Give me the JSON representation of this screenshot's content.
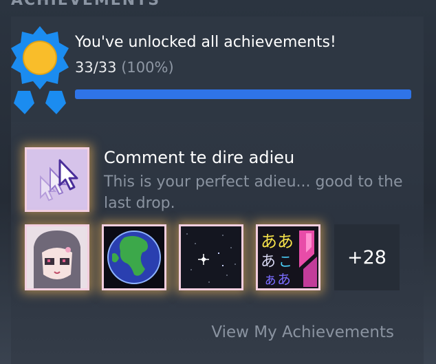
{
  "section": {
    "title": "ACHIEVEMENTS"
  },
  "summary": {
    "title": "You've unlocked all achievements!",
    "count": "33/33",
    "percent": "(100%)",
    "progress_fraction": 1.0
  },
  "featured": {
    "name": "Comment te dire adieu",
    "description": "This is your perfect adieu... good to the last drop."
  },
  "more": {
    "label": "+28"
  },
  "link": {
    "label": "View My Achievements"
  },
  "colors": {
    "accent": "#2f74e8",
    "badge_blue": "#1b8cf0",
    "badge_gold": "#f9bd2a",
    "frame_pink": "#f3cfe0",
    "glow": "#ffbe5a"
  },
  "icons": [
    "achievement-badge-icon",
    "cursor-icon",
    "anime-girl-icon",
    "earth-icon",
    "stars-icon",
    "japanese-text-icon"
  ]
}
